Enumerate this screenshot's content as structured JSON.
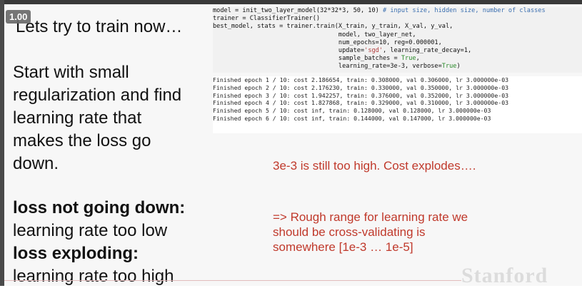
{
  "player": {
    "speed_badge": "1.00"
  },
  "slide": {
    "title": "Lets try to train now…",
    "body_lines": [
      "Start with small",
      "regularization and find",
      "learning rate that",
      "makes the loss go",
      "down."
    ],
    "notes": {
      "loss_not_going_down_heading": "loss not going down:",
      "loss_not_going_down_text": "learning rate too low",
      "loss_exploding_heading": "loss exploding:",
      "loss_exploding_text": "learning rate too high"
    },
    "code": {
      "line1": "model = init_two_layer_model(32*32*3, 50, 10)",
      "line1_comment": " # input size, hidden size, number of classes",
      "line2": "trainer = ClassifierTrainer()",
      "line3": "best_model, stats = trainer.train(X_train, y_train, X_val, y_val,",
      "line4": "                                  model, two_layer_net,",
      "line5": "                                  num_epochs=10, reg=0.000001,",
      "line6a": "                                  update=",
      "line6b": "'sgd'",
      "line6c": ", learning_rate_decay=1,",
      "line7a": "                                  sample_batches = ",
      "line7b": "True",
      "line7c": ",",
      "line8a": "                                  learning_rate=3e-3, verbose=",
      "line8b": "True",
      "line8c": ")"
    },
    "output_lines": [
      "Finished epoch 1 / 10: cost 2.186654, train: 0.308000, val 0.306000, lr 3.000000e-03",
      "Finished epoch 2 / 10: cost 2.176230, train: 0.330000, val 0.350000, lr 3.000000e-03",
      "Finished epoch 3 / 10: cost 1.942257, train: 0.376000, val 0.352000, lr 3.000000e-03",
      "Finished epoch 4 / 10: cost 1.827868, train: 0.329000, val 0.310000, lr 3.000000e-03",
      "Finished epoch 5 / 10: cost inf, train: 0.128000, val 0.128000, lr 3.000000e-03",
      "Finished epoch 6 / 10: cost inf, train: 0.144000, val 0.147000, lr 3.000000e-03"
    ],
    "annotation_1": "3e-3 is still too high. Cost explodes….",
    "annotation_2_lines": [
      "=> Rough range for learning rate we",
      "should be cross-validating is",
      "somewhere [1e-3 … 1e-5]"
    ],
    "logo_text": "Stanford"
  },
  "colors": {
    "annotation_red": "#c0392b",
    "comment_blue": "#3b6fb0",
    "string_red": "#b03b3b",
    "bool_green": "#2a8a2a"
  }
}
